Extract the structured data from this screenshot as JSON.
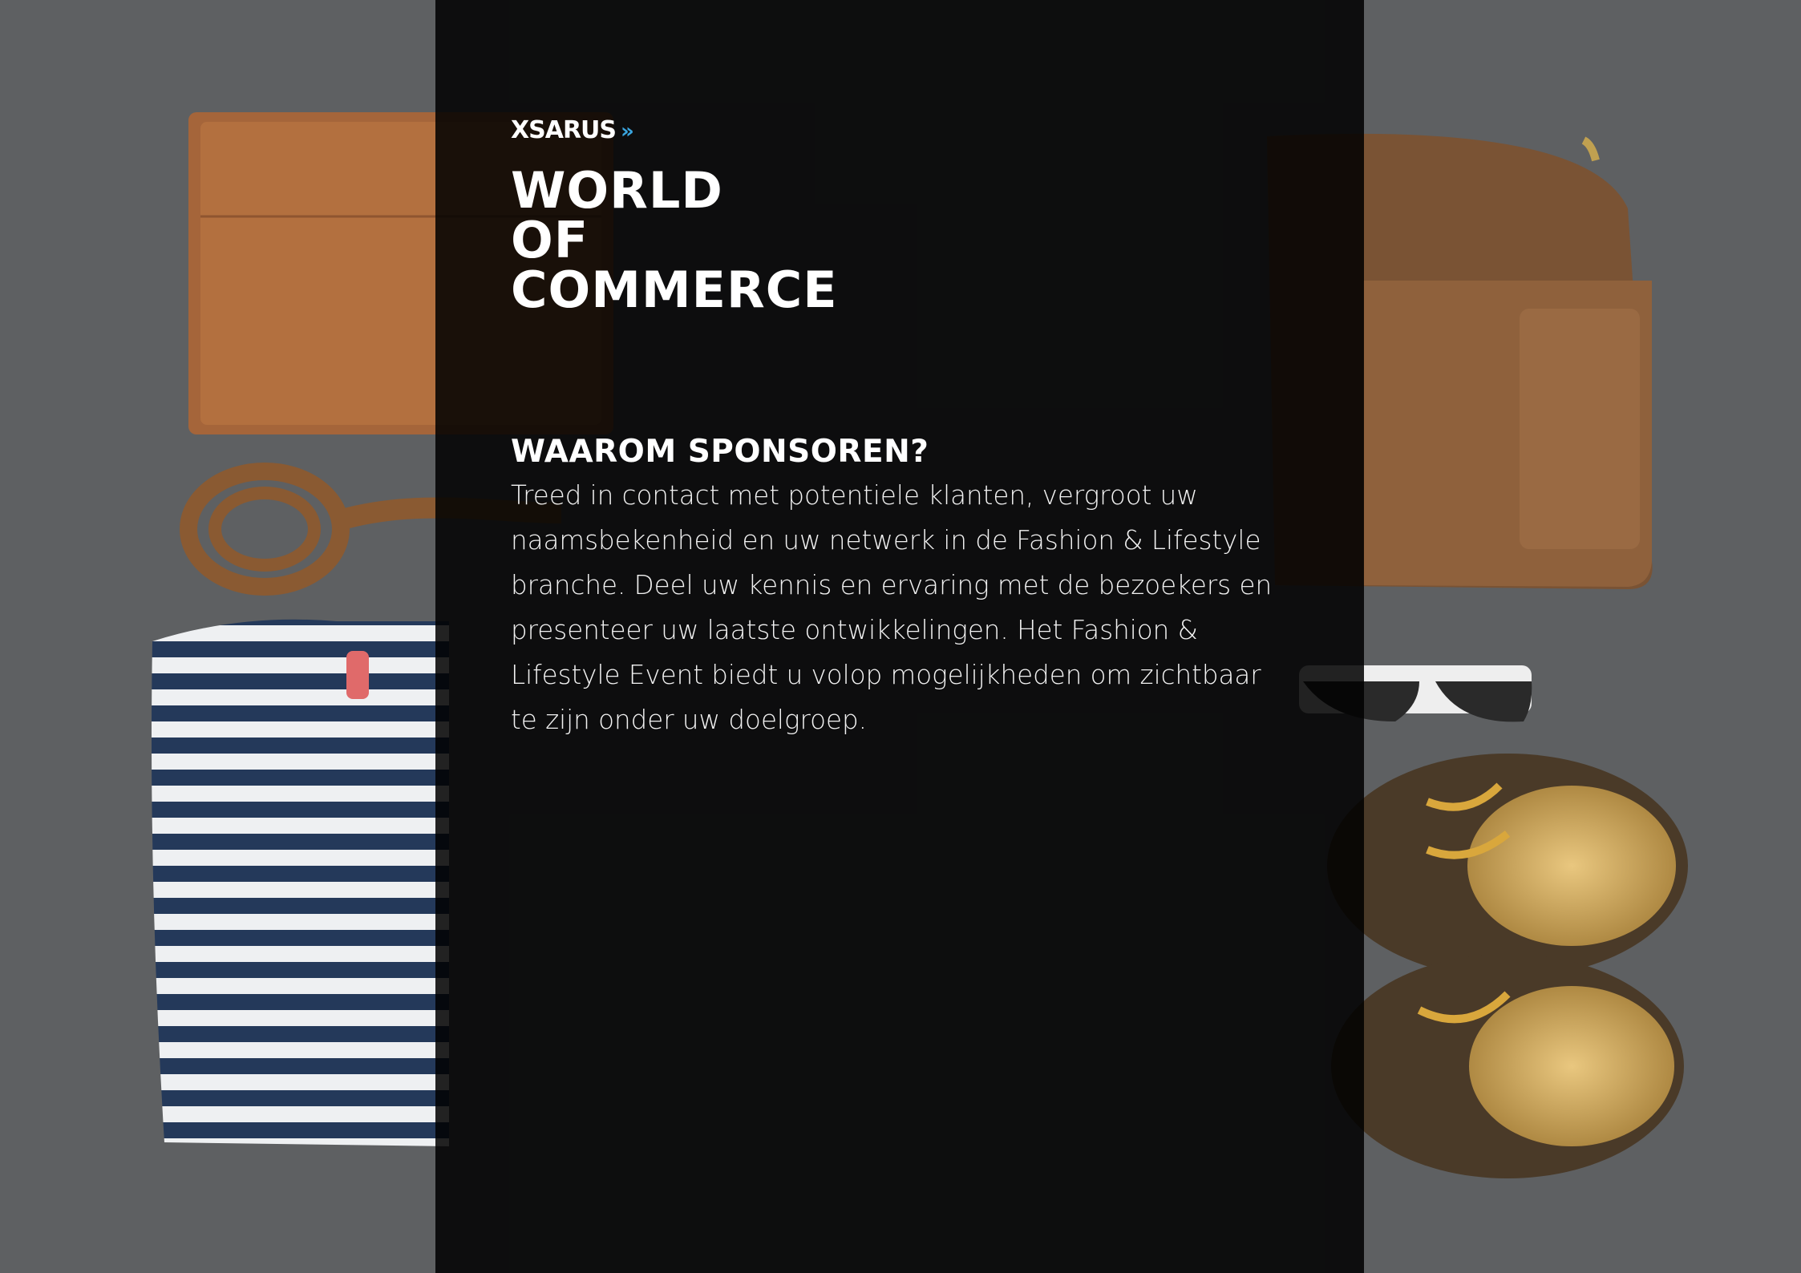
{
  "logo": {
    "text": "XSARUS",
    "chevrons": "»",
    "accent_color": "#3aa6e0"
  },
  "title": {
    "lines": [
      "WORLD",
      "OF",
      "COMMERCE"
    ]
  },
  "section": {
    "heading": "WAAROM SPONSOREN?",
    "body": "Treed in contact met potentiele klanten, vergroot uw naamsbekenheid en uw netwerk in de Fashion & Lifestyle branche. Deel uw kennis en ervaring met de bezoekers en presenteer uw laatste ontwikkelingen. Het Fashion & Lifestyle Event biedt u volop mogelijkheden om zichtbaar te zijn onder uw doelgroep."
  },
  "colors": {
    "panel": "#000000",
    "text": "#ffffff",
    "carpet": "#5f6163"
  }
}
